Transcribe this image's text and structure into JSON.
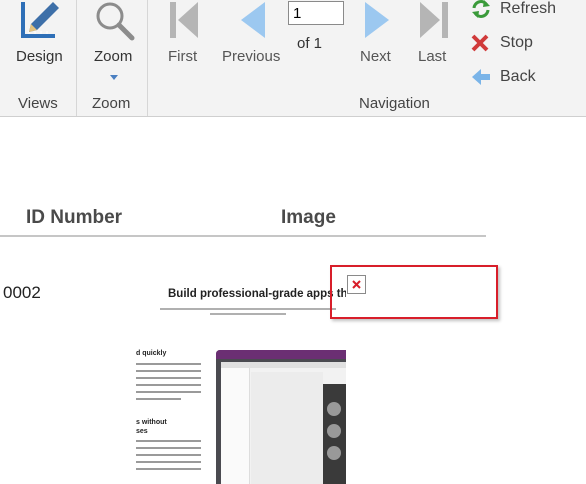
{
  "ribbon": {
    "views": {
      "design_label": "Design",
      "group_label": "Views"
    },
    "zoom": {
      "zoom_label": "Zoom",
      "group_label": "Zoom"
    },
    "navigation": {
      "first_label": "First",
      "previous_label": "Previous",
      "page_value": "1",
      "of_text": "of  1",
      "next_label": "Next",
      "last_label": "Last",
      "group_label": "Navigation"
    },
    "actions": {
      "refresh_label": "Refresh",
      "stop_label": "Stop",
      "back_label": "Back"
    }
  },
  "report": {
    "columns": [
      "ID Number",
      "Image"
    ],
    "rows": [
      {
        "id": "0002"
      }
    ],
    "image_preview": {
      "title": "Build professional-grade apps the",
      "left_heading_1": "d quickly",
      "left_heading_2": "s without\nses"
    }
  },
  "colors": {
    "ribbon_bg": "#f3f3f3",
    "icon_blue": "#7ab4e8",
    "icon_gray": "#b5b5b5",
    "highlight_red": "#d81e2a",
    "refresh_green": "#3a9a3a",
    "stop_red": "#d03a3a"
  },
  "icons": [
    "design-ruler-pencil-icon",
    "zoom-magnifier-icon",
    "first-page-icon",
    "previous-page-icon",
    "next-page-icon",
    "last-page-icon",
    "refresh-icon",
    "stop-icon",
    "back-icon",
    "broken-image-icon"
  ]
}
